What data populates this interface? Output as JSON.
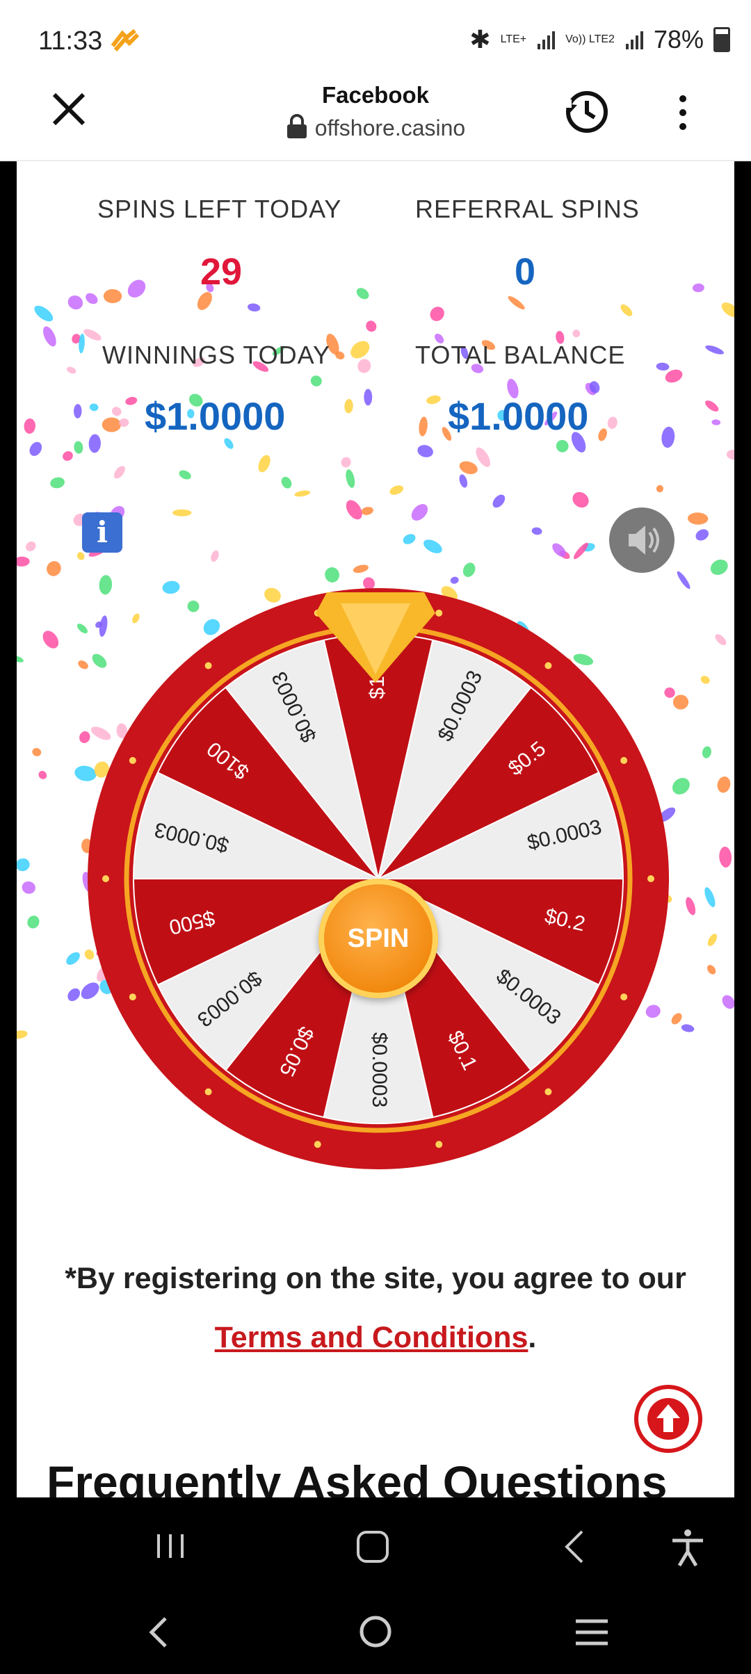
{
  "status_bar": {
    "time": "11:33",
    "network_label": "LTE+",
    "volte_label": "Vo)) LTE2",
    "battery": "78%"
  },
  "browser": {
    "title": "Facebook",
    "url": "offshore.casino"
  },
  "stats": {
    "spins_left_label": "SPINS LEFT TODAY",
    "spins_left_value": "29",
    "referral_label": "REFERRAL SPINS",
    "referral_value": "0",
    "winnings_label": "WINNINGS TODAY",
    "winnings_value": "$1.0000",
    "balance_label": "TOTAL BALANCE",
    "balance_value": "$1.0000"
  },
  "info_button": "i",
  "wheel": {
    "spin_label": "SPIN",
    "segments": [
      "$1",
      "$0.0003",
      "$0.5",
      "$0.0003",
      "$0.2",
      "$0.0003",
      "$0.1",
      "$0.0003",
      "$0.05",
      "$0.0003",
      "$500",
      "$0.0003",
      "$100",
      "$0.0003"
    ]
  },
  "footer": {
    "legal_text": "*By registering on the site, you agree to our",
    "terms_link": "Terms and Conditions",
    "terms_suffix": "."
  },
  "faq_heading": "Frequently Asked Questions",
  "colors": {
    "accent_red": "#d6161a",
    "blue": "#1565c0",
    "wheel_red": "#c8141a",
    "wheel_gold": "#f6a623"
  }
}
